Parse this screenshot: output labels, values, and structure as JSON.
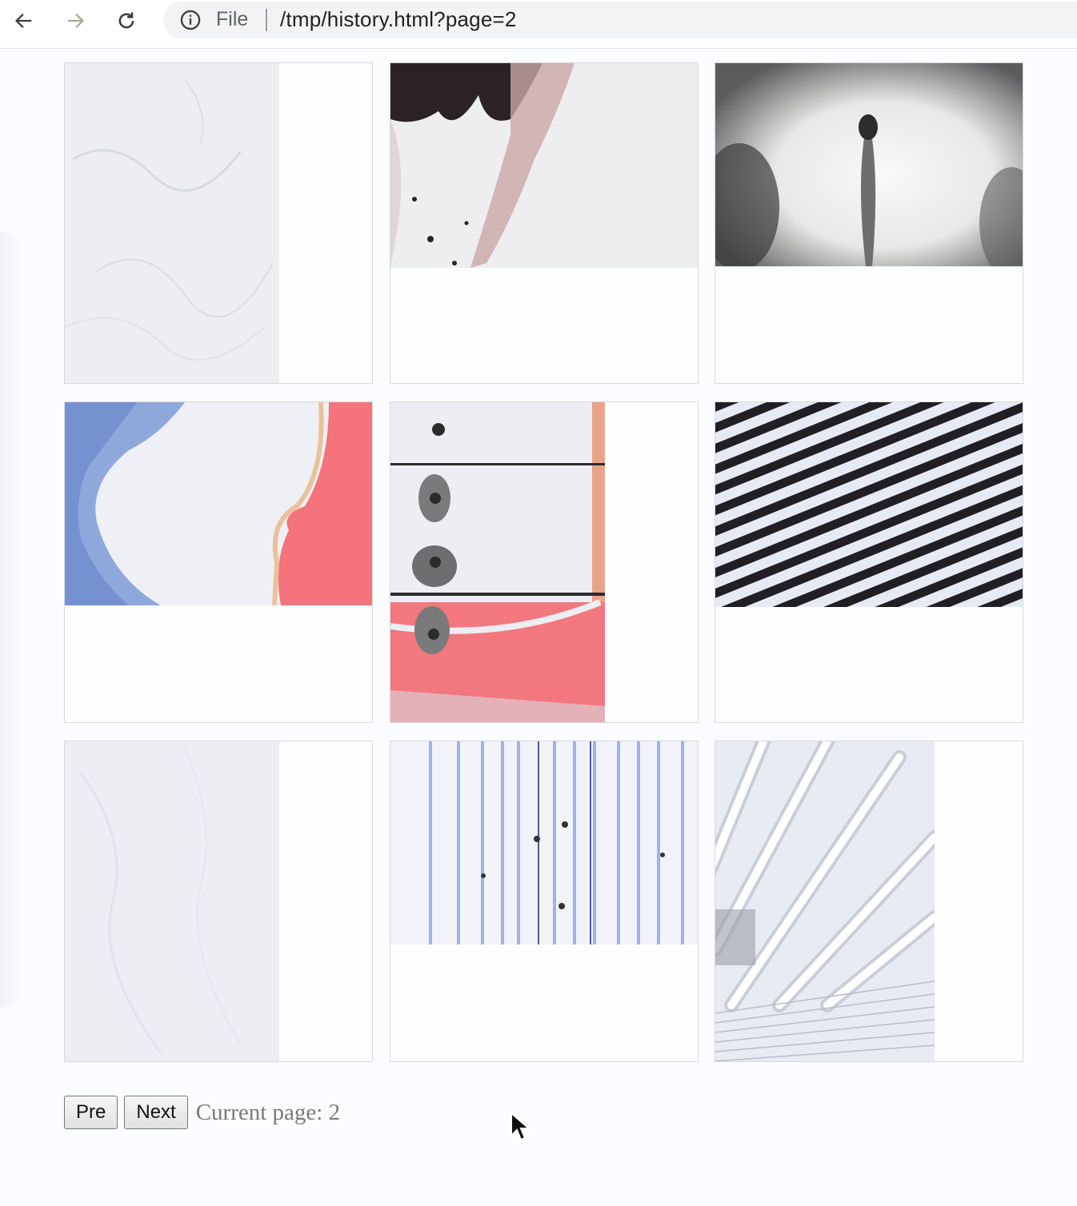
{
  "browser": {
    "scheme_label": "File",
    "url": "/tmp/history.html?page=2",
    "icons": {
      "back": "arrow-left-icon",
      "forward": "arrow-right-icon",
      "reload": "reload-icon",
      "info": "info-icon"
    }
  },
  "gallery": {
    "items": [
      {
        "subject": "white marble texture"
      },
      {
        "subject": "black ink smoke drips"
      },
      {
        "subject": "feather in light"
      },
      {
        "subject": "blue and coral paint waves"
      },
      {
        "subject": "peeling paint 7162"
      },
      {
        "subject": "black and white diagonal stripes"
      },
      {
        "subject": "pale grey marble texture"
      },
      {
        "subject": "blue vertical pipes"
      },
      {
        "subject": "white architectural pipes"
      }
    ]
  },
  "pager": {
    "pre_label": "Pre",
    "next_label": "Next",
    "status_text": "Current page: 2"
  }
}
